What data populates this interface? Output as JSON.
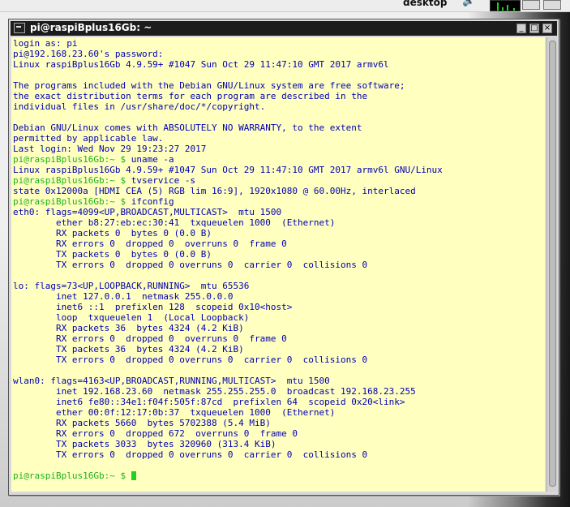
{
  "panel": {
    "desktop_label": "desktop",
    "icons": [
      "volume-icon",
      "cpu-monitor-icon",
      "clock-icon",
      "shutdown-icon"
    ]
  },
  "window": {
    "title": "pi@raspiBplus16Gb: ~",
    "buttons": {
      "minimize": "_",
      "maximize": "□",
      "close": "×"
    }
  },
  "colors": {
    "terminal_bg": "#ffffc0",
    "text": "#0000b4",
    "prompt": "#1cb11c",
    "cursor": "#20d020",
    "titlebar": "#1c1c1c"
  },
  "prompt": "pi@raspiBplus16Gb:~ $",
  "terminal_lines": [
    "login as: pi",
    "pi@192.168.23.60's password:",
    "Linux raspiBplus16Gb 4.9.59+ #1047 Sun Oct 29 11:47:10 GMT 2017 armv6l",
    "",
    "The programs included with the Debian GNU/Linux system are free software;",
    "the exact distribution terms for each program are described in the",
    "individual files in /usr/share/doc/*/copyright.",
    "",
    "Debian GNU/Linux comes with ABSOLUTELY NO WARRANTY, to the extent",
    "permitted by applicable law.",
    "Last login: Wed Nov 29 19:23:27 2017",
    "uname -a",
    "Linux raspiBplus16Gb 4.9.59+ #1047 Sun Oct 29 11:47:10 GMT 2017 armv6l GNU/Linux",
    "tvservice -s",
    "state 0x12000a [HDMI CEA (5) RGB lim 16:9], 1920x1080 @ 60.00Hz, interlaced",
    "ifconfig",
    "eth0: flags=4099<UP,BROADCAST,MULTICAST>  mtu 1500",
    "        ether b8:27:eb:ec:30:41  txqueuelen 1000  (Ethernet)",
    "        RX packets 0  bytes 0 (0.0 B)",
    "        RX errors 0  dropped 0  overruns 0  frame 0",
    "        TX packets 0  bytes 0 (0.0 B)",
    "        TX errors 0  dropped 0 overruns 0  carrier 0  collisions 0",
    "",
    "lo: flags=73<UP,LOOPBACK,RUNNING>  mtu 65536",
    "        inet 127.0.0.1  netmask 255.0.0.0",
    "        inet6 ::1  prefixlen 128  scopeid 0x10<host>",
    "        loop  txqueuelen 1  (Local Loopback)",
    "        RX packets 36  bytes 4324 (4.2 KiB)",
    "        RX errors 0  dropped 0  overruns 0  frame 0",
    "        TX packets 36  bytes 4324 (4.2 KiB)",
    "        TX errors 0  dropped 0 overruns 0  carrier 0  collisions 0",
    "",
    "wlan0: flags=4163<UP,BROADCAST,RUNNING,MULTICAST>  mtu 1500",
    "        inet 192.168.23.60  netmask 255.255.255.0  broadcast 192.168.23.255",
    "        inet6 fe80::34e1:f04f:505f:87cd  prefixlen 64  scopeid 0x20<link>",
    "        ether 00:0f:12:17:0b:37  txqueuelen 1000  (Ethernet)",
    "        RX packets 5660  bytes 5702388 (5.4 MiB)",
    "        RX errors 0  dropped 672  overruns 0  frame 0",
    "        TX packets 3033  bytes 320960 (313.4 KiB)",
    "        TX errors 0  dropped 0 overruns 0  carrier 0  collisions 0",
    "",
    ""
  ],
  "prompt_line_indices": [
    11,
    13,
    15,
    41
  ]
}
